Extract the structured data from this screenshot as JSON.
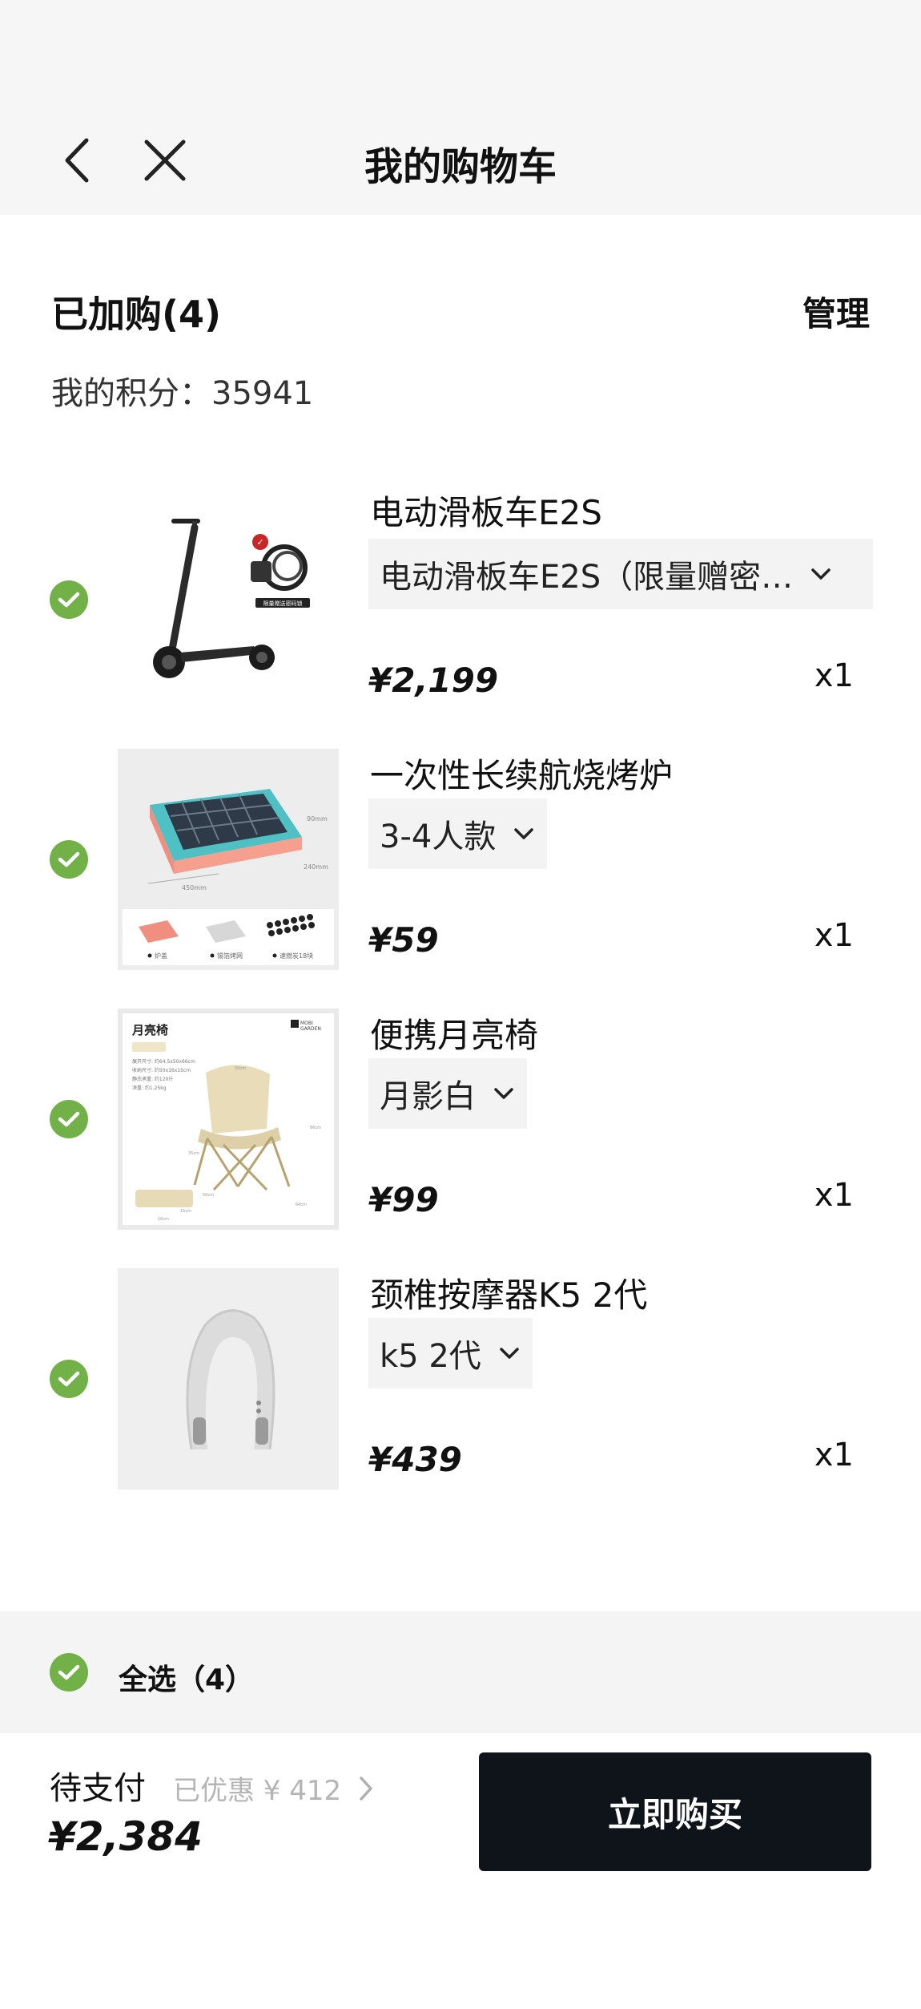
{
  "header": {
    "title": "我的购物车",
    "back_icon": "chevron-left-icon",
    "close_icon": "close-icon"
  },
  "cart": {
    "heading": "已加购(4)",
    "manage_label": "管理",
    "points_label": "我的积分：",
    "points_value": "35941"
  },
  "items": [
    {
      "name": "电动滑板车E2S",
      "spec": "电动滑板车E2S（限量赠密…",
      "price": "¥2,199",
      "qty": "x1",
      "checked": true,
      "image": "scooter-image"
    },
    {
      "name": "一次性长续航烧烤炉",
      "spec": "3-4人款",
      "price": "¥59",
      "qty": "x1",
      "checked": true,
      "image": "grill-image"
    },
    {
      "name": "便携月亮椅",
      "spec": "月影白",
      "price": "¥99",
      "qty": "x1",
      "checked": true,
      "image": "moon-chair-image"
    },
    {
      "name": "颈椎按摩器K5 2代",
      "spec": "k5 2代",
      "price": "¥439",
      "qty": "x1",
      "checked": true,
      "image": "neck-massager-image"
    }
  ],
  "footer": {
    "select_all_label": "全选（4）",
    "pay_label": "待支付",
    "discount_text": "已优惠 ¥ 412",
    "total": "¥2,384",
    "buy_label": "立即购买"
  },
  "colors": {
    "check_green": "#72b048",
    "buy_button": "#0f131a",
    "top_bar": "#f6f6f6"
  },
  "image_texts": {
    "scooter_gift": "限量赠送密码锁",
    "grill_dim_width": "450mm",
    "grill_dim_depth": "240mm",
    "grill_dim_height": "90mm",
    "grill_acc_1": "炉盖",
    "grill_acc_2": "锡箔烤网",
    "grill_acc_3": "速燃炭18块",
    "chair_title": "月亮椅",
    "chair_brand_1": "MOBI",
    "chair_brand_2": "GARDEN",
    "chair_spec_1": "展开尺寸: 约64.5x50x66cm",
    "chair_spec_2": "收纳尺寸: 约50x16x15cm",
    "chair_spec_3": "静态承重: 约120斤",
    "chair_spec_4": "净重: 约1.25kg",
    "chair_dim_a": "50cm",
    "chair_dim_b": "66cm",
    "chair_dim_c": "35cm",
    "chair_dim_d": "64cm",
    "chair_dim_e": "50cm",
    "chair_dim_f": "15cm",
    "chair_dim_g": "16cm"
  }
}
